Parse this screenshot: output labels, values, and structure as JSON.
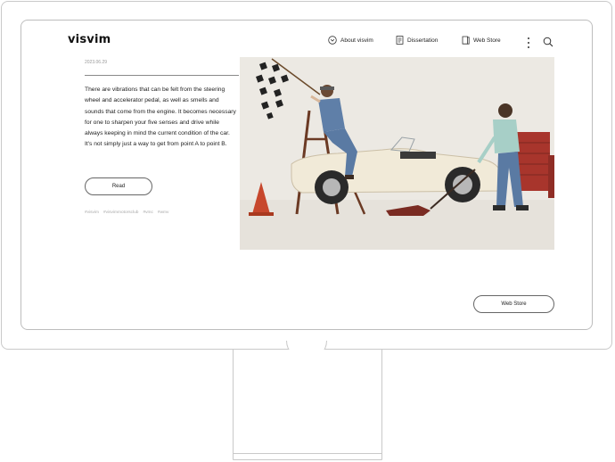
{
  "header": {
    "logo": "visvim",
    "nav": [
      {
        "label": "About visvim",
        "icon": "circle-chevron-down-icon"
      },
      {
        "label": "Dissertation",
        "icon": "document-icon"
      },
      {
        "label": "Web Store",
        "icon": "book-icon"
      }
    ]
  },
  "article": {
    "date": "2023.06.29",
    "body": "There are vibrations that can be felt from the steering wheel and accelerator pedal, as well as smells and sounds that come from the engine. It becomes necessary for one to sharpen your five senses and drive while always keeping in mind the current condition of the car. It's not simply just a way to get from point A to point B.",
    "read_label": "Read",
    "tags": [
      "#visvim",
      "#visvimmotorsclub",
      "#vmc",
      "#wmv"
    ]
  },
  "footer": {
    "web_store_label": "Web Store"
  }
}
